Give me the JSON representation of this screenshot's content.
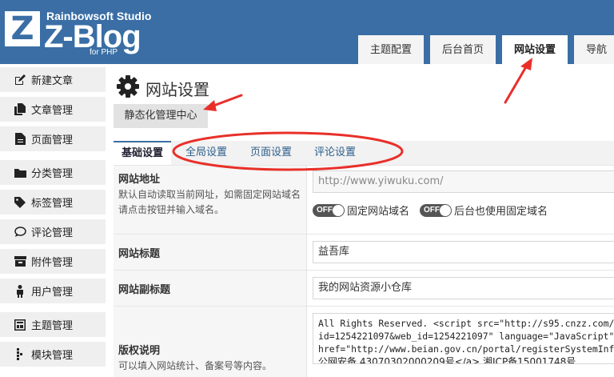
{
  "brand": {
    "studio": "Rainbowsoft Studio",
    "name": "Z-Blog",
    "platform": "for PHP",
    "logo_letter": "Z"
  },
  "topnav": {
    "tabs": [
      {
        "label": "主题配置",
        "active": false
      },
      {
        "label": "后台首页",
        "active": false
      },
      {
        "label": "网站设置",
        "active": true
      },
      {
        "label": "导航",
        "active": false
      }
    ]
  },
  "sidebar": {
    "items": [
      {
        "label": "新建文章",
        "icon": "pencil-square-icon"
      },
      {
        "label": "文章管理",
        "icon": "copy-icon"
      },
      {
        "label": "页面管理",
        "icon": "file-icon"
      },
      {
        "label": "分类管理",
        "icon": "folder-icon"
      },
      {
        "label": "标签管理",
        "icon": "tag-icon"
      },
      {
        "label": "评论管理",
        "icon": "chat-icon"
      },
      {
        "label": "附件管理",
        "icon": "inbox-icon"
      },
      {
        "label": "用户管理",
        "icon": "person-icon"
      },
      {
        "label": "主题管理",
        "icon": "layout-icon"
      },
      {
        "label": "模块管理",
        "icon": "modules-icon"
      }
    ]
  },
  "page": {
    "title": "网站设置",
    "static_button": "静态化管理中心"
  },
  "subtabs": [
    {
      "label": "基础设置",
      "active": true
    },
    {
      "label": "全局设置",
      "active": false
    },
    {
      "label": "页面设置",
      "active": false
    },
    {
      "label": "评论设置",
      "active": false
    }
  ],
  "form": {
    "site_url": {
      "label": "网站地址",
      "desc": "默认自动读取当前网址，如需固定网站域名请点击按钮并输入域名。",
      "value": "http://www.yiwuku.com/",
      "switch1_state": "OFF",
      "switch1_label": "固定网站域名",
      "switch2_state": "OFF",
      "switch2_label": "后台也使用固定域名"
    },
    "site_title": {
      "label": "网站标题",
      "value": "益吾库"
    },
    "site_subtitle": {
      "label": "网站副标题",
      "value": "我的网站资源小仓库"
    },
    "copyright": {
      "label": "版权说明",
      "desc": "可以填入网站统计、备案号等内容。",
      "lines": [
        "All Rights Reserved. <script src=\"http://s95.cnzz.com/",
        "id=1254221097&web_id=1254221097\" language=\"JavaScript\"",
        "href=\"http://www.beian.gov.cn/portal/registerSystemInf",
        "公网安备 43070302000209号</a> 湘ICP备15001748号"
      ]
    }
  },
  "colors": {
    "header_bg": "#3a6ea5",
    "annotation": "#e8302a"
  }
}
